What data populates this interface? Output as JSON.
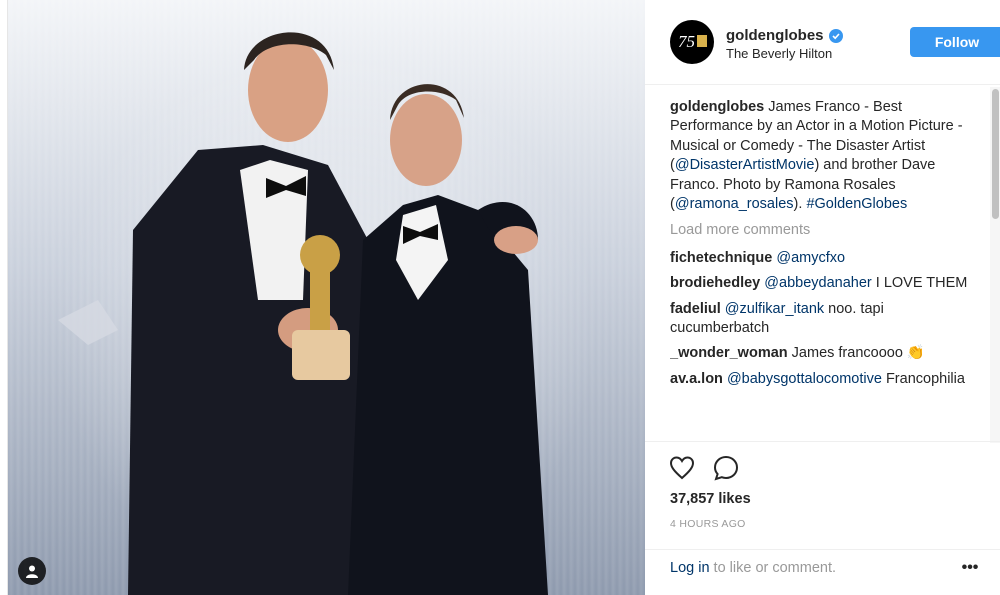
{
  "post": {
    "account": "goldenglobes",
    "location": "The Beverly Hilton",
    "follow_label": "Follow",
    "avatar_text": "75"
  },
  "caption": {
    "user": "goldenglobes",
    "text_1": "James Franco - Best Performance by an Actor in a Motion Picture - Musical or Comedy - The Disaster Artist (",
    "mention_1": "@DisasterArtistMovie",
    "text_2": ") and brother Dave Franco. Photo by Ramona Rosales (",
    "mention_2": "@ramona_rosales",
    "text_3": "). ",
    "hashtag": "#GoldenGlobes"
  },
  "load_more": "Load more comments",
  "comments": [
    {
      "user": "fichetechnique",
      "mention": "@amycfxo",
      "text": ""
    },
    {
      "user": "brodiehedley",
      "mention": "@abbeydanaher",
      "text": "I LOVE THEM"
    },
    {
      "user": "fadeliul",
      "mention": "@zulfikar_itank",
      "text": "noo. tapi cucumberbatch"
    },
    {
      "user": "_wonder_woman",
      "mention": "",
      "text": "James francoooo 👏"
    },
    {
      "user": "av.a.lon",
      "mention": "@babysgottalocomotive",
      "text": "Francophilia"
    }
  ],
  "engagement": {
    "likes": "37,857 likes",
    "time": "4 HOURS AGO"
  },
  "footer": {
    "login_link": "Log in",
    "login_rest": " to like or comment.",
    "more": "•••"
  },
  "colors": {
    "accent": "#3897f0",
    "link": "#003569",
    "muted": "#999999"
  },
  "icons": [
    "heart-icon",
    "comment-icon",
    "verified-badge-icon",
    "user-tag-icon",
    "more-options-icon"
  ]
}
